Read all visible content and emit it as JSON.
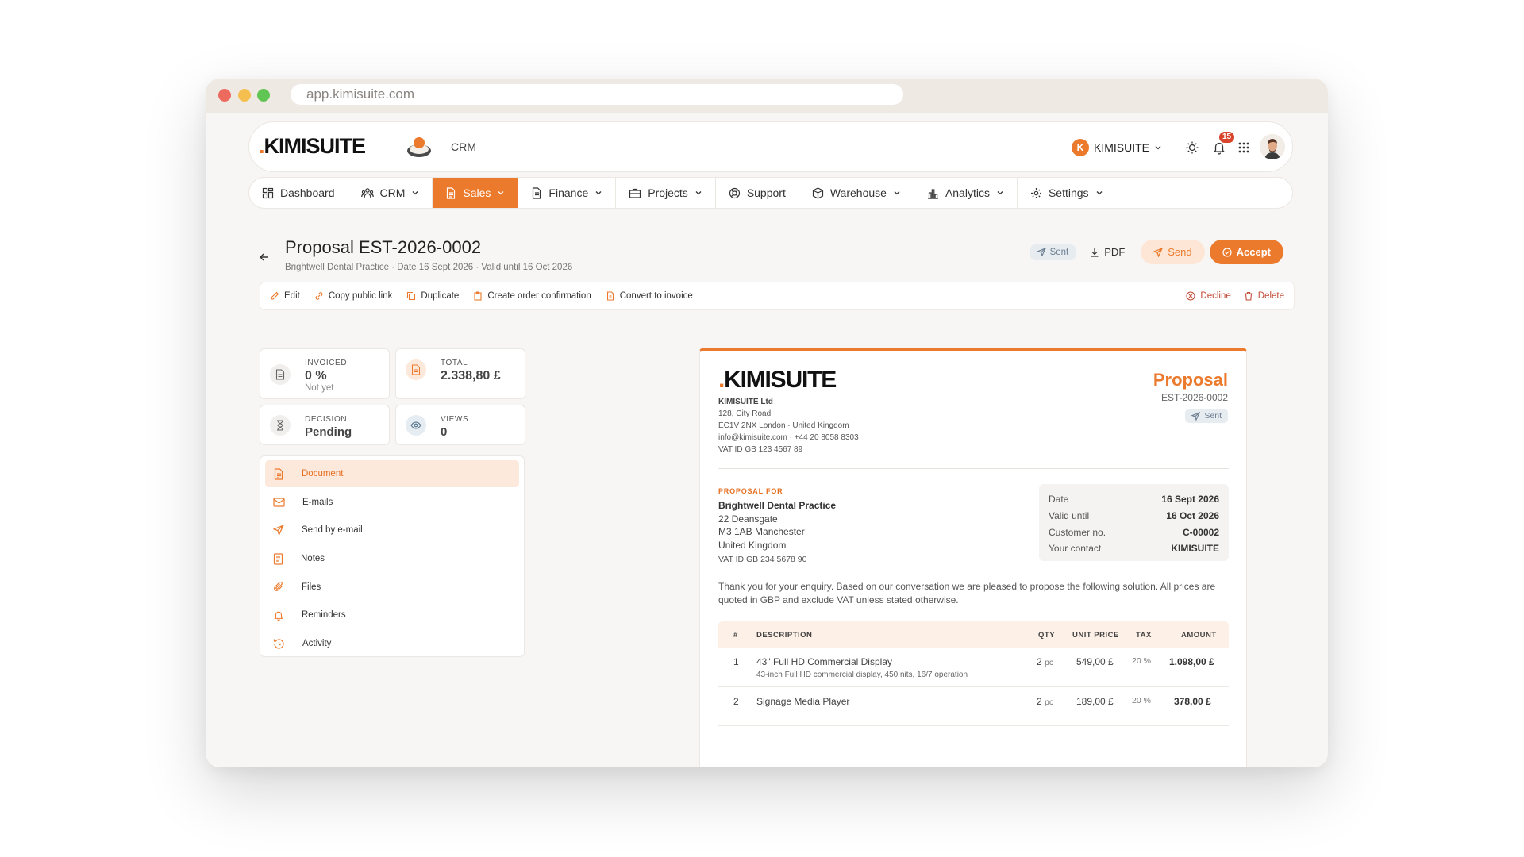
{
  "browser": {
    "url": "app.kimisuite.com"
  },
  "brand": {
    "logo_dot": ".",
    "logo_text": "KIMISUITE",
    "accent": "#ec7a2c"
  },
  "topbar": {
    "module_label": "CRM",
    "company_initial": "K",
    "company_name": "KIMISUITE",
    "notifications_count": "15"
  },
  "nav": {
    "dashboard": "Dashboard",
    "crm": "CRM",
    "sales": "Sales",
    "finance": "Finance",
    "projects": "Projects",
    "support": "Support",
    "warehouse": "Warehouse",
    "analytics": "Analytics",
    "settings": "Settings"
  },
  "header": {
    "title": "Proposal EST-2026-0002",
    "subtitle": "Brightwell Dental Practice · Date 16 Sept 2026 · Valid until 16 Oct 2026",
    "status": "Sent",
    "pdf": "PDF",
    "send": "Send",
    "accept": "Accept"
  },
  "toolbar": {
    "edit": "Edit",
    "copy_link": "Copy public link",
    "duplicate": "Duplicate",
    "order_confirmation": "Create order confirmation",
    "convert_invoice": "Convert to invoice",
    "decline": "Decline",
    "delete": "Delete"
  },
  "stats": {
    "invoiced": {
      "label": "Invoiced",
      "value": "0 %",
      "note": "Not yet"
    },
    "total": {
      "label": "Total",
      "value": "2.338,80 £"
    },
    "decision": {
      "label": "Decision",
      "value": "Pending"
    },
    "views": {
      "label": "Views",
      "value": "0"
    }
  },
  "menu": {
    "items": [
      "Document",
      "E-mails",
      "Send by e-mail",
      "Notes",
      "Files",
      "Reminders",
      "Activity"
    ]
  },
  "document": {
    "type": "Proposal",
    "number": "EST-2026-0002",
    "status": "Sent",
    "company": {
      "name": "KIMISUITE Ltd",
      "street": "128, City Road",
      "city": "EC1V 2NX London · United Kingdom",
      "contact": "info@kimisuite.com · +44 20 8058 8303",
      "vat": "VAT ID GB 123 4567 89"
    },
    "proposal_for_label": "PROPOSAL FOR",
    "customer": {
      "name": "Brightwell Dental Practice",
      "street": "22 Deansgate",
      "city": "M3 1AB Manchester",
      "country": "United Kingdom",
      "vat": "VAT ID GB 234 5678 90"
    },
    "meta": [
      {
        "label": "Date",
        "value": "16 Sept 2026"
      },
      {
        "label": "Valid until",
        "value": "16 Oct 2026"
      },
      {
        "label": "Customer no.",
        "value": "C-00002"
      },
      {
        "label": "Your contact",
        "value": "KIMISUITE"
      }
    ],
    "intro": "Thank you for your enquiry. Based on our conversation we are pleased to propose the following solution. All prices are quoted in GBP and exclude VAT unless stated otherwise.",
    "table": {
      "headers": {
        "num": "#",
        "desc": "DESCRIPTION",
        "qty": "QTY",
        "unit": "UNIT PRICE",
        "tax": "TAX",
        "amount": "AMOUNT"
      },
      "rows": [
        {
          "num": "1",
          "desc": "43\" Full HD Commercial Display",
          "sub": "43-inch Full HD commercial display, 450 nits, 16/7 operation",
          "qty": "2",
          "qty_unit": "pc",
          "unit": "549,00 £",
          "tax": "20 %",
          "amount": "1.098,00 £"
        },
        {
          "num": "2",
          "desc": "Signage Media Player",
          "sub": "",
          "qty": "2",
          "qty_unit": "pc",
          "unit": "189,00 £",
          "tax": "20 %",
          "amount": "378,00 £"
        }
      ]
    }
  }
}
